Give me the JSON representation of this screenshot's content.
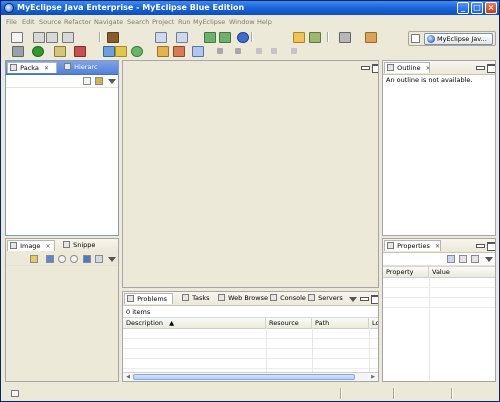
{
  "window": {
    "title": "MyEclipse Java Enterprise - MyEclipse Blue Edition",
    "controls": [
      "_",
      "□",
      "×"
    ]
  },
  "menus": [
    "File",
    "Edit",
    "Source",
    "Refactor",
    "Navigate",
    "Search",
    "Project",
    "Run",
    "MyEclipse",
    "Window",
    "Help"
  ],
  "perspective": {
    "label": "MyEclipse Jav..."
  },
  "left_top_panel": {
    "tabs": [
      "Packa",
      "Hierarc"
    ]
  },
  "left_bottom_panel": {
    "tabs": [
      "Image",
      "Snippe"
    ]
  },
  "outline_panel": {
    "tab": "Outline",
    "message": "An outline is not available."
  },
  "properties_panel": {
    "tab": "Properties",
    "columns": [
      "Property",
      "Value"
    ]
  },
  "problems_panel": {
    "tabs": [
      "Problems",
      "Tasks",
      "Web Browser",
      "Console",
      "Servers"
    ],
    "item_count": "0 items",
    "columns": [
      "Description",
      "Resource",
      "Path",
      "Lo"
    ]
  },
  "icons": {
    "app": "myeclipse-icon",
    "perspective": "myeclipse-perspective-icon"
  },
  "colors": {
    "titlebar": "#1b63d8",
    "accent": "#5180d9",
    "menu_text": "#7e7b6f",
    "chrome": "#ece9d8"
  }
}
